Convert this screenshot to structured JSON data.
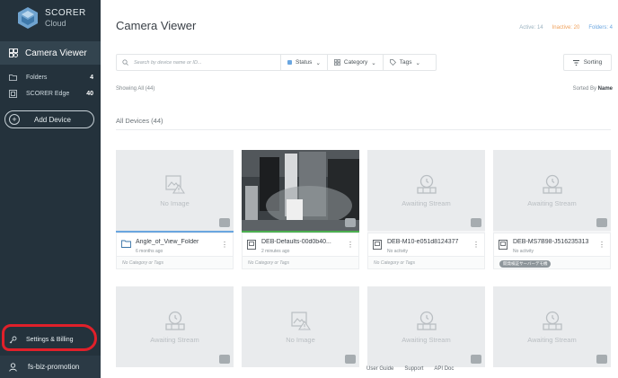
{
  "brand": {
    "name": "SCORER",
    "sub": "Cloud"
  },
  "sidebar": {
    "active_item": "Camera Viewer",
    "items": [
      {
        "label": "Folders",
        "count": "4"
      },
      {
        "label": "SCORER Edge",
        "count": "40"
      }
    ],
    "add_device": "Add Device",
    "settings": "Settings & Billing",
    "user": "fs-biz-promotion"
  },
  "header": {
    "title": "Camera Viewer",
    "active": "Active: 14",
    "inactive": "Inactive: 20",
    "folders": "Folders: 4"
  },
  "toolbar": {
    "search_placeholder": "Search by device name or ID...",
    "status": "Status",
    "category": "Category",
    "tags": "Tags",
    "sorting": "Sorting"
  },
  "listing": {
    "showing": "Showing All (44)",
    "sorted_by_label": "Sorted By",
    "sorted_by_value": "Name",
    "section_title": "All Devices (44)"
  },
  "cards": [
    {
      "thumb_text": "No Image",
      "name": "Angle_of_View_Folder",
      "sub": "6 months ago",
      "tags": "No Category or Tags"
    },
    {
      "thumb_text": "",
      "name": "DEB-Defaults-00d0b40...",
      "sub": "2 minutes ago",
      "tags": "No Category or Tags"
    },
    {
      "thumb_text": "Awaiting Stream",
      "name": "DEB-M10-e051d8124377",
      "sub": "No activity",
      "tags": "No Category or Tags"
    },
    {
      "thumb_text": "Awaiting Stream",
      "name": "DEB-MS7B98-J516235313",
      "sub": "No activity",
      "tag_chip": "開発検証サーバーデモ機"
    },
    {
      "thumb_text": "Awaiting Stream"
    },
    {
      "thumb_text": "No Image"
    },
    {
      "thumb_text": "Awaiting Stream"
    },
    {
      "thumb_text": "Awaiting Stream"
    }
  ],
  "footer": {
    "guide": "User Guide",
    "support": "Support",
    "api": "API Doc"
  },
  "colors": {
    "sidebar": "#24323c",
    "active_green": "#4caf50",
    "folder_blue": "#6aa6e0",
    "annotation_red": "#e0202a"
  }
}
